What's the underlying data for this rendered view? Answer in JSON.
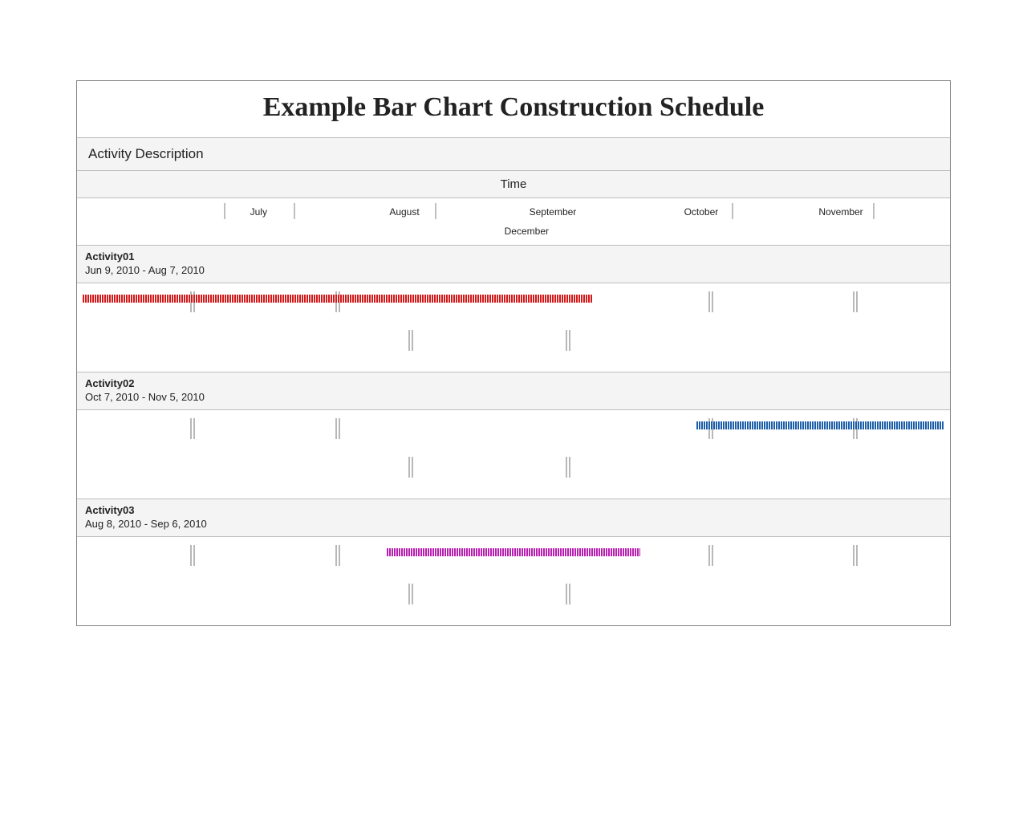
{
  "title": "Example Bar Chart Construction Schedule",
  "section_label": "Activity Description",
  "time_label": "Time",
  "months": {
    "row1": [
      {
        "label": "July",
        "label_pct": 20.8,
        "ticks_pct": [
          16.8,
          24.8
        ]
      },
      {
        "label": "August",
        "label_pct": 37.5,
        "ticks_pct": [
          41.0
        ]
      },
      {
        "label": "September",
        "label_pct": 54.5,
        "ticks_pct": []
      },
      {
        "label": "October",
        "label_pct": 71.5,
        "ticks_pct": [
          75.0
        ]
      },
      {
        "label": "November",
        "label_pct": 87.5,
        "ticks_pct": [
          91.2
        ]
      }
    ],
    "row2": [
      {
        "label": "December",
        "label_pct": 51.5
      }
    ]
  },
  "timeline_ticks": {
    "upper_pct": [
      13.0,
      29.6,
      72.3,
      88.9
    ],
    "lower_pct": [
      38.0,
      56.0
    ]
  },
  "activities": [
    {
      "name": "Activity01",
      "range": "Jun 9, 2010 - Aug 7, 2010",
      "bar": {
        "start_pct": 0.6,
        "end_pct": 59.0,
        "color": "#d11a1a"
      }
    },
    {
      "name": "Activity02",
      "range": "Oct 7, 2010 - Nov 5, 2010",
      "bar": {
        "start_pct": 71.0,
        "end_pct": 99.4,
        "color": "#1c5ea8"
      }
    },
    {
      "name": "Activity03",
      "range": "Aug 8, 2010 - Sep 6, 2010",
      "bar": {
        "start_pct": 35.5,
        "end_pct": 64.5,
        "color": "#b81fb0"
      }
    }
  ],
  "chart_data": {
    "type": "gantt",
    "title": "Example Bar Chart Construction Schedule",
    "x_axis": "Time",
    "categories": [
      "July",
      "August",
      "September",
      "October",
      "November",
      "December"
    ],
    "tasks": [
      {
        "name": "Activity01",
        "start": "2010-06-09",
        "end": "2010-08-07"
      },
      {
        "name": "Activity02",
        "start": "2010-10-07",
        "end": "2010-11-05"
      },
      {
        "name": "Activity03",
        "start": "2010-08-08",
        "end": "2010-09-06"
      }
    ]
  }
}
